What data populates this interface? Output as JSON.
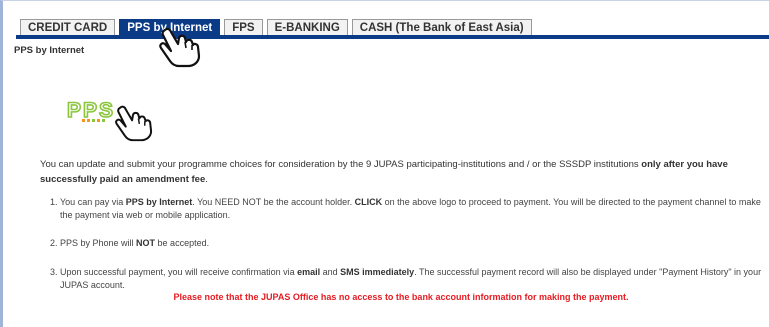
{
  "tabs": [
    {
      "label": "CREDIT CARD",
      "active": false
    },
    {
      "label": "PPS by Internet",
      "active": true
    },
    {
      "label": "FPS",
      "active": false
    },
    {
      "label": "E-BANKING",
      "active": false
    },
    {
      "label": "CASH (The Bank of East Asia)",
      "active": false
    }
  ],
  "section_title": "PPS by Internet",
  "logo": {
    "icon": "pps-logo",
    "text": "PPS"
  },
  "intro": {
    "part1": "You can update and submit your programme choices for consideration by the 9 JUPAS participating-institutions and / or the SSSDP institutions ",
    "bold": "only after you have successfully paid an amendment fee",
    "part2": "."
  },
  "items": [
    {
      "num": "1.",
      "t1": "You can pay via ",
      "b1": "PPS by Internet",
      "t2": ". You NEED NOT be the account holder. ",
      "b2": "CLICK",
      "t3": " on the above logo to proceed to payment. You will be directed to the payment channel to make the payment via web or mobile application."
    },
    {
      "num": "2.",
      "t1": "PPS by Phone will ",
      "b1": "NOT",
      "t2": " be accepted."
    },
    {
      "num": "3.",
      "t1": "Upon successful payment, you will receive confirmation via ",
      "b1": "email",
      "t2": " and ",
      "b2": "SMS immediately",
      "t3": ". The successful payment record will also be displayed under \"Payment History\" in your JUPAS account."
    }
  ],
  "notice": "Please note that the JUPAS Office has no access to the bank account information for making the payment.",
  "colors": {
    "tab_active": "#0b3a86",
    "notice": "#e51c23",
    "logo_green": "#8cc63f",
    "logo_orange": "#f7941d"
  }
}
